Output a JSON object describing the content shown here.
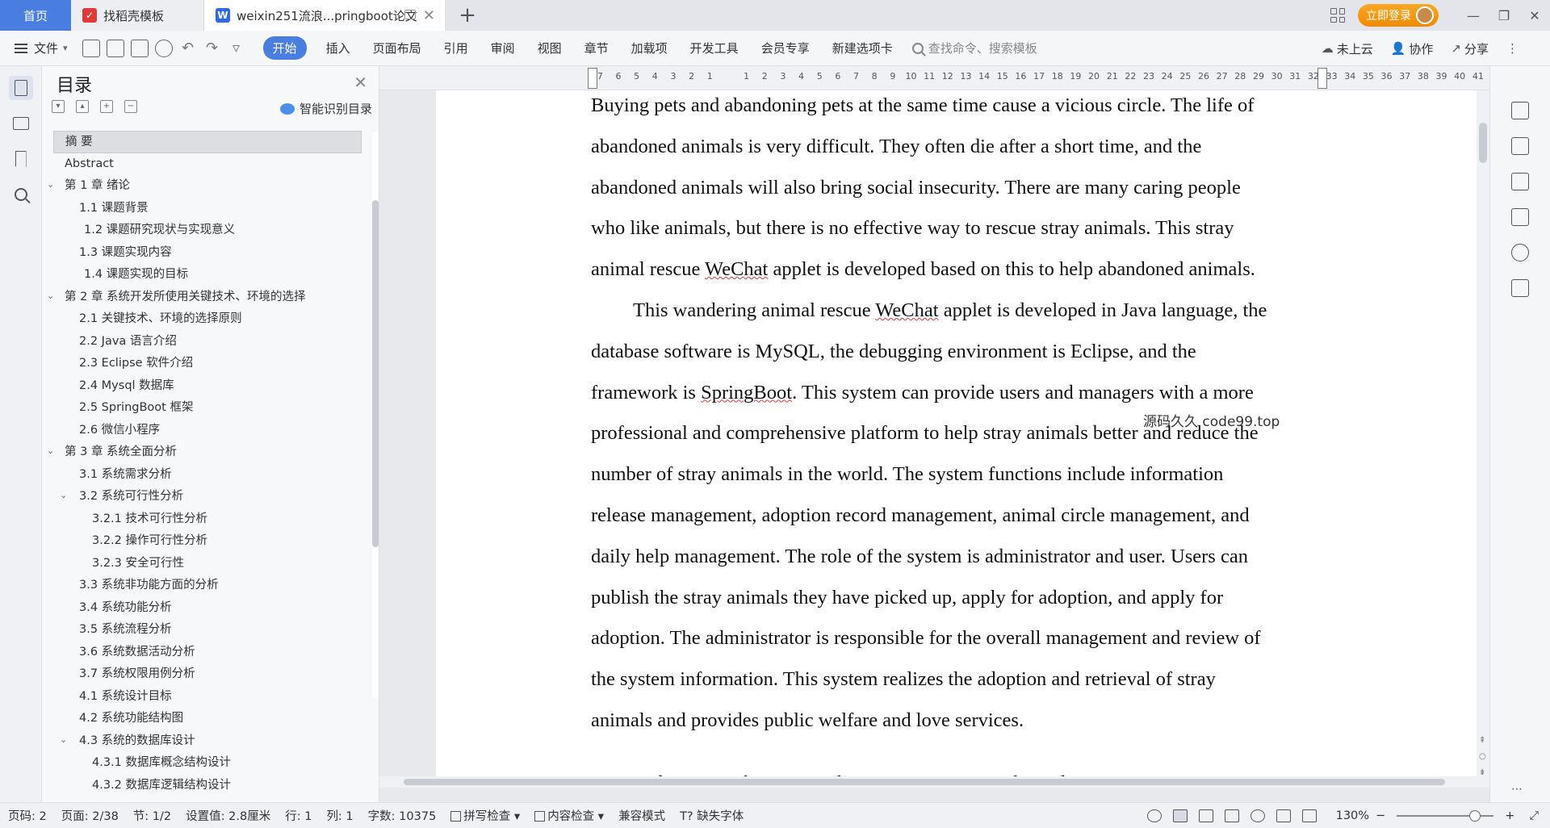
{
  "tabs": {
    "home": "首页",
    "template": "找稻壳模板",
    "document": "weixin251流浪...pringboot论文"
  },
  "header": {
    "login": "立即登录"
  },
  "ribbon": {
    "file": "文件",
    "tabs": [
      "开始",
      "插入",
      "页面布局",
      "引用",
      "审阅",
      "视图",
      "章节",
      "加载项",
      "开发工具",
      "会员专享",
      "新建选项卡"
    ],
    "search_placeholder": "查找命令、搜索模板",
    "cloud": "未上云",
    "collab": "协作",
    "share": "分享"
  },
  "toc": {
    "title": "目录",
    "smart": "智能识别目录",
    "items": [
      {
        "label": "摘  要",
        "level": 0,
        "selected": true,
        "arrow": false
      },
      {
        "label": "Abstract",
        "level": 0,
        "arrow": false
      },
      {
        "label": "第 1 章  绪论",
        "level": 0,
        "arrow": true
      },
      {
        "label": "1.1 课题背景",
        "level": 1,
        "arrow": false
      },
      {
        "label": "1.2 课题研究现状与实现意义",
        "level": 1.3,
        "arrow": false
      },
      {
        "label": "1.3 课题实现内容",
        "level": 1,
        "arrow": false
      },
      {
        "label": "1.4 课题实现的目标",
        "level": 1.3,
        "arrow": false
      },
      {
        "label": "第 2 章  系统开发所使用关键技术、环境的选择",
        "level": 0,
        "arrow": true
      },
      {
        "label": "2.1 关键技术、环境的选择原则",
        "level": 1,
        "arrow": false
      },
      {
        "label": "2.2 Java 语言介绍",
        "level": 1,
        "arrow": false
      },
      {
        "label": "2.3 Eclipse 软件介绍",
        "level": 1,
        "arrow": false
      },
      {
        "label": "2.4 Mysql 数据库",
        "level": 1,
        "arrow": false
      },
      {
        "label": "2.5 SpringBoot 框架",
        "level": 1,
        "arrow": false
      },
      {
        "label": "2.6 微信小程序",
        "level": 1,
        "arrow": false
      },
      {
        "label": "第 3 章  系统全面分析",
        "level": 0,
        "arrow": true
      },
      {
        "label": "3.1 系统需求分析",
        "level": 1,
        "arrow": false
      },
      {
        "label": "3.2 系统可行性分析",
        "level": 1,
        "arrow": true
      },
      {
        "label": "3.2.1 技术可行性分析",
        "level": 2,
        "arrow": false
      },
      {
        "label": "3.2.2 操作可行性分析",
        "level": 2,
        "arrow": false
      },
      {
        "label": "3.2.3 安全可行性",
        "level": 2,
        "arrow": false
      },
      {
        "label": "3.3 系统非功能方面的分析",
        "level": 1,
        "arrow": false
      },
      {
        "label": "3.4 系统功能分析",
        "level": 1,
        "arrow": false
      },
      {
        "label": "3.5 系统流程分析",
        "level": 1,
        "arrow": false
      },
      {
        "label": "3.6 系统数据活动分析",
        "level": 1,
        "arrow": false
      },
      {
        "label": "3.7 系统权限用例分析",
        "level": 1,
        "arrow": false
      },
      {
        "label": "4.1 系统设计目标",
        "level": 1,
        "arrow": false
      },
      {
        "label": "4.2 系统功能结构图",
        "level": 1,
        "arrow": false
      },
      {
        "label": "4.3 系统的数据库设计",
        "level": 1,
        "arrow": true
      },
      {
        "label": "4.3.1 数据库概念结构设计",
        "level": 2,
        "arrow": false
      },
      {
        "label": "4.3.2 数据库逻辑结构设计",
        "level": 2,
        "arrow": false
      }
    ]
  },
  "ruler": {
    "marks": [
      "7",
      "6",
      "5",
      "4",
      "3",
      "2",
      "1",
      "",
      "1",
      "2",
      "3",
      "4",
      "5",
      "6",
      "7",
      "8",
      "9",
      "10",
      "11",
      "12",
      "13",
      "14",
      "15",
      "16",
      "17",
      "18",
      "19",
      "20",
      "21",
      "22",
      "23",
      "24",
      "25",
      "26",
      "27",
      "28",
      "29",
      "30",
      "31",
      "32",
      "33",
      "34",
      "35",
      "36",
      "37",
      "38",
      "39",
      "40",
      "41"
    ]
  },
  "document": {
    "para1": [
      "Buying pets and abandoning pets at the same time cause a vicious circle. The life of",
      "abandoned animals is very difficult. They often die after a short time, and the",
      "abandoned animals will also bring social insecurity. There are many caring people",
      "who like animals, but there is no effective way to rescue stray animals. This stray"
    ],
    "para1_last_pre": "animal rescue ",
    "para1_last_sq": "WeChat",
    "para1_last_post": " applet is developed based on this to help abandoned animals.",
    "para2_l1_pre": "This wandering animal rescue ",
    "para2_l1_sq": "WeChat",
    "para2_l1_post": " applet is developed in Java language, the",
    "para2_l2": "database software is MySQL, the debugging environment is Eclipse, and the",
    "para2_l3_pre": "framework is ",
    "para2_l3_sq": "SpringBoot",
    "para2_l3_post": ". This system can provide users and managers with a more",
    "para2_rest": [
      "professional and comprehensive platform to help stray animals better and reduce the",
      "number of stray animals in the world. The system functions include information",
      "release management, adoption record management, animal circle management, and",
      "daily help management. The role of the system is administrator and user. Users can",
      "publish the stray animals they have picked up, apply for adoption, and apply for",
      "adoption. The administrator is responsible for the overall management and review of",
      "the system information. This system realizes the adoption and retrieval of stray",
      "animals and provides public welfare and love services."
    ],
    "watermark": "源码久久 code99.top",
    "next_line": "Keywords: Java; information release management; Online adoption; Animal circle"
  },
  "status": {
    "page_num": "页码: 2",
    "pages": "页面: 2/38",
    "section": "节: 1/2",
    "setting": "设置值: 2.8厘米",
    "row": "行: 1",
    "col": "列: 1",
    "words": "字数: 10375",
    "spell": "拼写检查",
    "content_check": "内容检查",
    "compat": "兼容模式",
    "missing_font": "缺失字体",
    "zoom": "130%"
  }
}
